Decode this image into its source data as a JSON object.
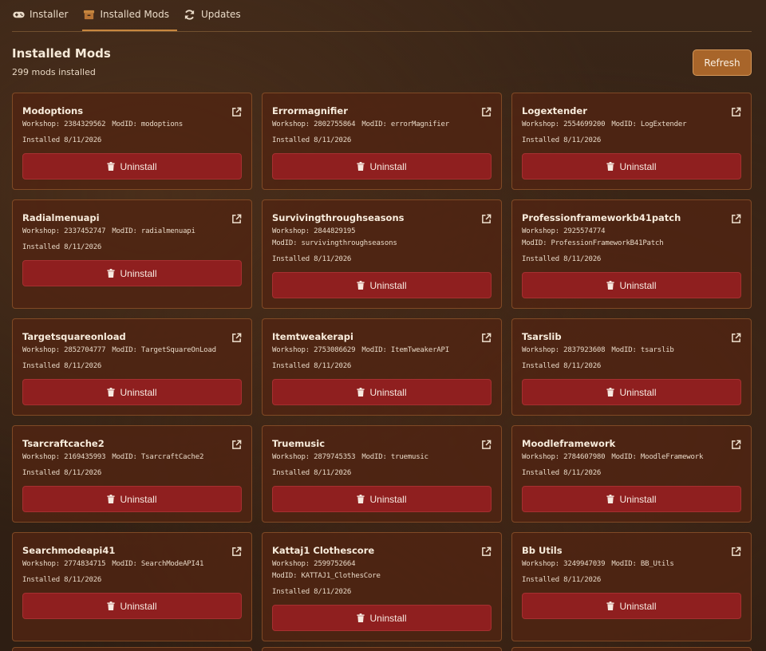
{
  "tabs": [
    {
      "label": "Installer",
      "icon": "gamepad-icon"
    },
    {
      "label": "Installed Mods",
      "icon": "box-icon"
    },
    {
      "label": "Updates",
      "icon": "sync-icon"
    }
  ],
  "header": {
    "title": "Installed Mods",
    "count": "299 mods installed",
    "refresh_label": "Refresh"
  },
  "colors": {
    "accent": "#c8873f",
    "uninstall": "#8f1f1f",
    "refresh": "#a8652a"
  },
  "mods": [
    {
      "name": "Modoptions",
      "workshop": "Workshop: 2384329562",
      "modid": "ModID: modoptions",
      "installed": "Installed 8/11/2026",
      "uninstall": "Uninstall"
    },
    {
      "name": "Errormagnifier",
      "workshop": "Workshop: 2802755864",
      "modid": "ModID: errorMagnifier",
      "installed": "Installed 8/11/2026",
      "uninstall": "Uninstall"
    },
    {
      "name": "Logextender",
      "workshop": "Workshop: 2554699200",
      "modid": "ModID: LogExtender",
      "installed": "Installed 8/11/2026",
      "uninstall": "Uninstall"
    },
    {
      "name": "Radialmenuapi",
      "workshop": "Workshop: 2337452747",
      "modid": "ModID: radialmenuapi",
      "installed": "Installed 8/11/2026",
      "uninstall": "Uninstall"
    },
    {
      "name": "Survivingthroughseasons",
      "workshop": "Workshop: 2844829195",
      "modid": "ModID: survivingthroughseasons",
      "installed": "Installed 8/11/2026",
      "uninstall": "Uninstall",
      "wrap": true
    },
    {
      "name": "Professionframeworkb41patch",
      "workshop": "Workshop: 2925574774",
      "modid": "ModID: ProfessionFrameworkB41Patch",
      "installed": "Installed 8/11/2026",
      "uninstall": "Uninstall",
      "wrap": true
    },
    {
      "name": "Targetsquareonload",
      "workshop": "Workshop: 2852704777",
      "modid": "ModID: TargetSquareOnLoad",
      "installed": "Installed 8/11/2026",
      "uninstall": "Uninstall"
    },
    {
      "name": "Itemtweakerapi",
      "workshop": "Workshop: 2753086629",
      "modid": "ModID: ItemTweakerAPI",
      "installed": "Installed 8/11/2026",
      "uninstall": "Uninstall"
    },
    {
      "name": "Tsarslib",
      "workshop": "Workshop: 2837923608",
      "modid": "ModID: tsarslib",
      "installed": "Installed 8/11/2026",
      "uninstall": "Uninstall"
    },
    {
      "name": "Tsarcraftcache2",
      "workshop": "Workshop: 2169435993",
      "modid": "ModID: TsarcraftCache2",
      "installed": "Installed 8/11/2026",
      "uninstall": "Uninstall"
    },
    {
      "name": "Truemusic",
      "workshop": "Workshop: 2879745353",
      "modid": "ModID: truemusic",
      "installed": "Installed 8/11/2026",
      "uninstall": "Uninstall"
    },
    {
      "name": "Moodleframework",
      "workshop": "Workshop: 2784607980",
      "modid": "ModID: MoodleFramework",
      "installed": "Installed 8/11/2026",
      "uninstall": "Uninstall"
    },
    {
      "name": "Searchmodeapi41",
      "workshop": "Workshop: 2774834715",
      "modid": "ModID: SearchModeAPI41",
      "installed": "Installed 8/11/2026",
      "uninstall": "Uninstall"
    },
    {
      "name": "Kattaj1 Clothescore",
      "workshop": "Workshop: 2599752664",
      "modid": "ModID: KATTAJ1_ClothesCore",
      "installed": "Installed 8/11/2026",
      "uninstall": "Uninstall",
      "wrap": true
    },
    {
      "name": "Bb Utils",
      "workshop": "Workshop: 3249947039",
      "modid": "ModID: BB_Utils",
      "installed": "Installed 8/11/2026",
      "uninstall": "Uninstall"
    }
  ]
}
